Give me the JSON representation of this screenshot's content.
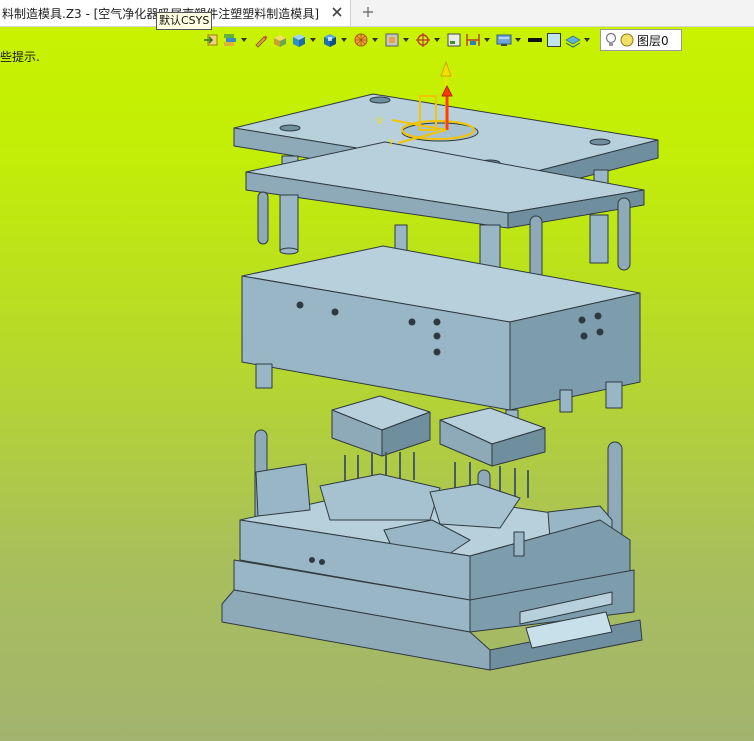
{
  "tab": {
    "title": "料制造模具.Z3 - [空气净化器吸尾壳塑件注塑塑料制造模具]",
    "close_icon": "close-icon",
    "add_icon": "plus-icon"
  },
  "tooltip": {
    "text": "默认CSYS"
  },
  "viewport": {
    "prompt": "些提示.",
    "background_top": "#c8f200",
    "background_bottom": "#a2b46d"
  },
  "toolbar": {
    "icons": [
      "exit-sketch-icon",
      "layer-manager-icon",
      "pencil-icon",
      "shaded-box-icon",
      "solid-box-icon",
      "view-box-icon",
      "render-icon",
      "filter-icon",
      "axis-target-icon",
      "datum-icon",
      "dimension-icon",
      "display-settings-icon",
      "line-color-icon",
      "face-color-icon",
      "layer-stack-icon",
      "light-bulb-icon"
    ],
    "layer_label": "图层0"
  },
  "model": {
    "name": "injection-mold-assembly",
    "colors": {
      "steel": "#98b6c6",
      "steel_dark": "#6f8e9e",
      "steel_light": "#b7d0dc",
      "edge": "#2f3a40"
    },
    "csys_axes": [
      "Z",
      "V",
      "Y"
    ]
  }
}
